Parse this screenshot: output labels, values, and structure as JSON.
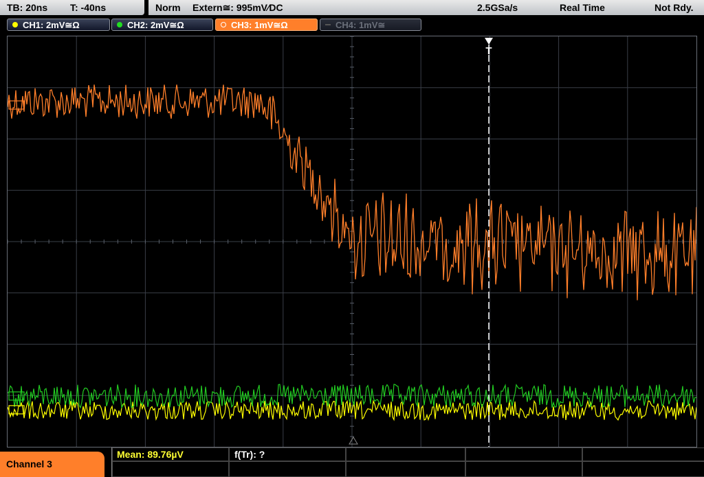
{
  "status": {
    "timebase": "TB: 20ns",
    "trigger_time": "T: -40ns",
    "mode": "Norm",
    "trigger_source": "Extern≅: 995mV∕DC",
    "sample_rate": "2.5GSa/s",
    "acq_mode": "Real Time",
    "state": "Not Rdy."
  },
  "channels": [
    {
      "label": "CH1: 2mV≅Ω",
      "color": "#ffff00",
      "state": "on"
    },
    {
      "label": "CH2: 2mV≅Ω",
      "color": "#22dd22",
      "state": "on"
    },
    {
      "label": "CH3: 1mV≅Ω",
      "color": "#ff7f2a",
      "state": "active"
    },
    {
      "label": "CH4: 1mV≅",
      "color": "#555555",
      "state": "off"
    }
  ],
  "trigger_marker": "T",
  "measurements": {
    "channel_tab": "Channel 3",
    "mean": "Mean: 89.76µV",
    "f_tr": "f(Tr): ?"
  },
  "colors": {
    "ch1": "#ffff00",
    "ch2": "#22cc22",
    "ch3": "#ff7f2a",
    "grid": "#3a3f48",
    "trigger_line": "#ffffff",
    "mean_text": "#ffff33"
  }
}
